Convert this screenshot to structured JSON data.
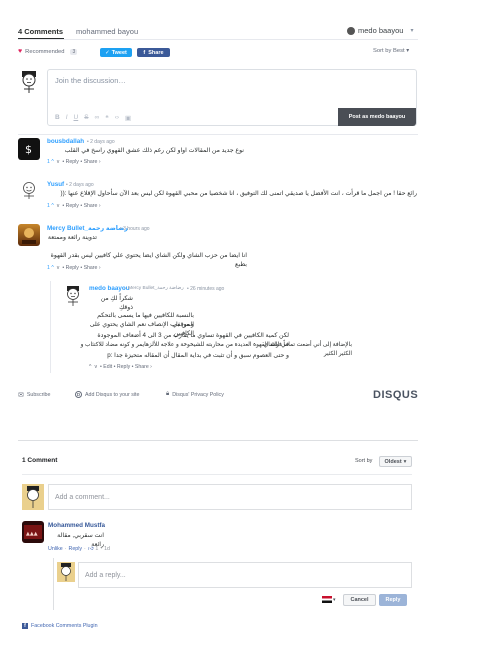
{
  "disqus": {
    "tab_comments": "4 Comments",
    "tab_site": "mohammed bayou",
    "login_user": "medo baayou",
    "recommend_label": "Recommended",
    "recommend_count": "3",
    "tweet_label": "Tweet",
    "share_label": "Share",
    "sort_label": "Sort by Best",
    "compose_placeholder": "Join the discussion…",
    "post_button": "Post as medo baayou",
    "toolbar_icons": [
      "B",
      "I",
      "U",
      "S",
      "link",
      "quote",
      "code",
      "image"
    ],
    "comments": [
      {
        "author": "bousbdallah",
        "time": "• 2 days ago",
        "text": "نوع جديد من المقالات اواو لكن رغم ذلك عشق القهوي راسخ في القلب",
        "votes": "1 ^",
        "vote_down": "v",
        "actions": "• Reply • Share ›"
      },
      {
        "author": "Yusuf",
        "time": "• 2 days ago",
        "text": "رائع حقا ! من اجمل ما قرأت ، انت الأفضل يا صديقي اتمنى لك التوفيق ، انا شخصيا من محبي القهوة لكن ليس بعد الآن سأحاول الإقلاع عنها :((",
        "votes": "1 ^",
        "vote_down": "v",
        "actions": "• Reply • Share ›"
      },
      {
        "author": "Mercy Bullet_رضاضة رحمة",
        "time": "• 3 hours ago",
        "text_lines": [
          "تدوينة رائعة وممتعة",
          "انا ايضا من حزب الشاي ولكن الشاي ايضا يحتوي علي كافيين ليس بقدر القهوة بطبع"
        ],
        "votes": "1 ^",
        "vote_down": "v",
        "actions": "• Reply • Share ›"
      },
      {
        "author": "medo baayou",
        "reply_to": "→ Mercy Bullet_رضاضة رحمة",
        "time": "• 26 minutes ago",
        "text_lines": [
          "شكراً لكِ من ذوقكِ",
          "بالنسبة للكافيين فيها ما يسمى بالتحكم الموقفي",
          "و من باب الإنصاف نعم الشاي يحتوي على الكافيين",
          "لكن كمية الكافيين في القهوة تساوي ما يقارب من 3 الى 4 أضعاف الموجودة في الشاي",
          "بالإضافة إلى أني أضعت تماماً فوائد القهوة العديدة من محاربته للشيخوخة و علاجه للألزهايمر و كونه مضاد للاكتئاب و الكثير الكثير",
          "و حتى العصوم سبق و أن تثبت في بداية المقال أن المقاله متحيزة جدا :p"
        ],
        "votes": "^",
        "vote_down": "v",
        "actions": "• Edit • Reply • Share ›"
      }
    ],
    "footer": {
      "subscribe": "Subscribe",
      "add_disqus": "Add Disqus to your site",
      "privacy": "Disqus' Privacy Policy",
      "logo": "DISQUS"
    }
  },
  "facebook": {
    "count_label": "1 Comment",
    "sort_label": "Sort by",
    "sort_value": "Oldest",
    "add_placeholder": "Add a comment...",
    "comment": {
      "author": "Mohammed Mustfa",
      "text": "انت سقربي, مقالة رائعة",
      "like": "Unlike",
      "reply": "Reply",
      "likes": "1",
      "time": "1d"
    },
    "reply_placeholder": "Add a reply...",
    "cancel_button": "Cancel",
    "reply_button": "Reply",
    "plugin_label": "Facebook Comments Plugin"
  },
  "colors": {
    "disqus_blue": "#2e9fff",
    "twitter": "#1da1f2",
    "facebook": "#3b5998",
    "heart": "#e0245e"
  }
}
